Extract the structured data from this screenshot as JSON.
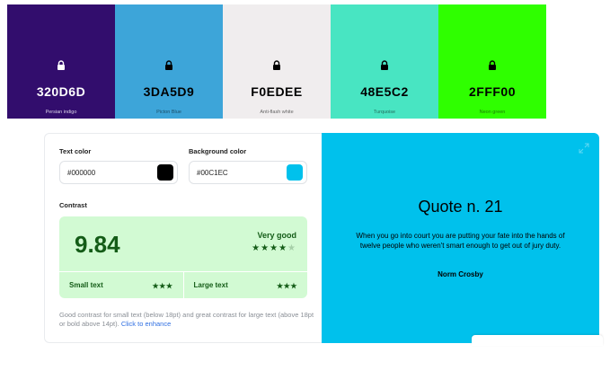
{
  "palette": [
    {
      "hex": "320D6D",
      "name": "Persian indigo",
      "bg": "#320D6D",
      "fg": "#ffffff",
      "lock_icon": "lock-icon"
    },
    {
      "hex": "3DA5D9",
      "name": "Picton Blue",
      "bg": "#3DA5D9",
      "fg": "#000000",
      "lock_icon": "lock-icon"
    },
    {
      "hex": "F0EDEE",
      "name": "Anti-flash white",
      "bg": "#F0EDEE",
      "fg": "#000000",
      "lock_icon": "lock-icon"
    },
    {
      "hex": "48E5C2",
      "name": "Turquoise",
      "bg": "#48E5C2",
      "fg": "#000000",
      "lock_icon": "lock-icon"
    },
    {
      "hex": "2FFF00",
      "name": "Neon green",
      "bg": "#2FFF00",
      "fg": "#000000",
      "lock_icon": "lock-icon"
    }
  ],
  "text_color": {
    "label": "Text color",
    "value": "#000000",
    "chip": "#000000"
  },
  "background_color": {
    "label": "Background color",
    "value": "#00C1EC",
    "chip": "#00C1EC"
  },
  "contrast": {
    "label": "Contrast",
    "ratio": "9.84",
    "rating": "Very good",
    "stars_on": "★★★★",
    "stars_off": "★",
    "small_text_label": "Small text",
    "small_text_stars": "★★★",
    "large_text_label": "Large text",
    "large_text_stars": "★★★",
    "description": "Good contrast for small text (below 18pt) and great contrast for large text (above 18pt or bold above 14pt).",
    "link": "Click to enhance"
  },
  "quote": {
    "title": "Quote n. 21",
    "text": "When you go into court you are putting your fate into the hands of twelve people who weren't smart enough to get out of jury duty.",
    "author": "Norm Crosby",
    "expand_icon": "expand-icon"
  }
}
